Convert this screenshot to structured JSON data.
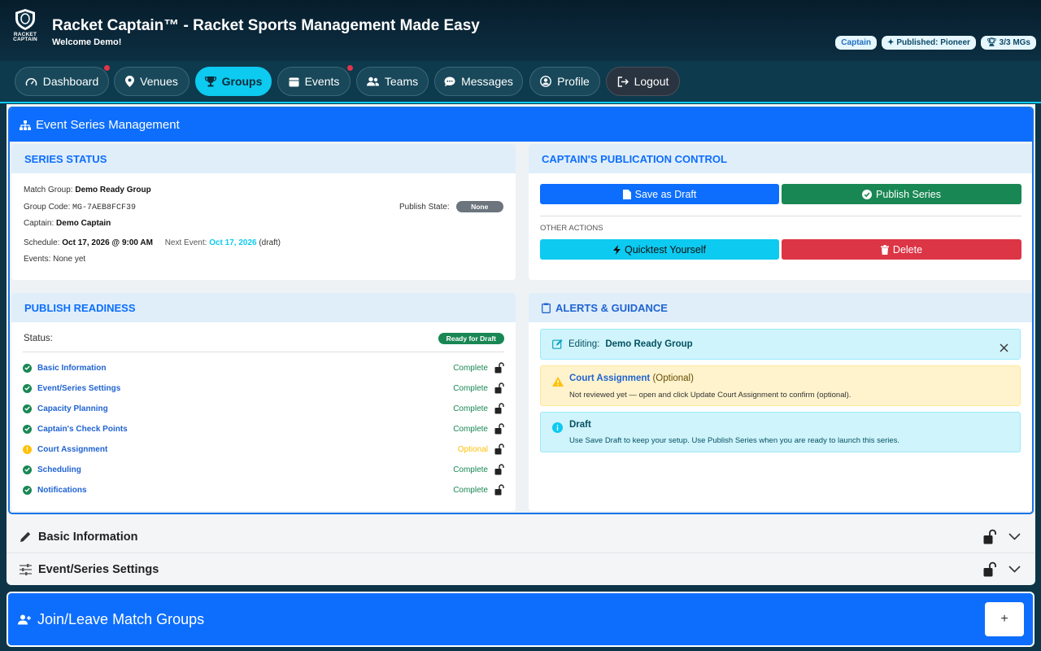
{
  "header": {
    "title": "Racket Captain™ - Racket Sports Management Made Easy",
    "welcome": "Welcome Demo!",
    "logo_text_line1": "RACKET",
    "logo_text_line2": "CAPTAIN",
    "badges": {
      "role": "Captain",
      "published": "Published: Pioneer",
      "mgs": "3/3 MGs"
    }
  },
  "nav": {
    "dashboard": "Dashboard",
    "venues": "Venues",
    "groups": "Groups",
    "events": "Events",
    "teams": "Teams",
    "messages": "Messages",
    "profile": "Profile",
    "logout": "Logout",
    "active": "Groups"
  },
  "esm": {
    "title": "Event Series Management",
    "series_status": {
      "title": "SERIES STATUS",
      "match_group_label": "Match Group:",
      "match_group": "Demo Ready Group",
      "group_code_label": "Group Code:",
      "group_code": "MG-7AEB8FCF39",
      "publish_state_label": "Publish State:",
      "publish_state": "None",
      "captain_label": "Captain:",
      "captain": "Demo Captain",
      "schedule_label": "Schedule:",
      "schedule": "Oct 17, 2026 @ 9:00 AM",
      "next_event_label": "Next Event:",
      "next_event": "Oct 17, 2026",
      "next_event_note": "(draft)",
      "events_label": "Events:",
      "events": "None yet"
    },
    "publication": {
      "title": "CAPTAIN'S PUBLICATION CONTROL",
      "save_draft": "Save as Draft",
      "publish": "Publish Series",
      "other_actions": "OTHER ACTIONS",
      "quicktest": "Quicktest Yourself",
      "delete": "Delete"
    },
    "readiness": {
      "title": "PUBLISH READINESS",
      "status_label": "Status:",
      "status": "Ready for Draft",
      "items": [
        {
          "label": "Basic Information",
          "status": "Complete",
          "state": "ok"
        },
        {
          "label": "Event/Series Settings",
          "status": "Complete",
          "state": "ok"
        },
        {
          "label": "Capacity Planning",
          "status": "Complete",
          "state": "ok"
        },
        {
          "label": "Captain's Check Points",
          "status": "Complete",
          "state": "ok"
        },
        {
          "label": "Court Assignment",
          "status": "Optional",
          "state": "warn"
        },
        {
          "label": "Scheduling",
          "status": "Complete",
          "state": "ok"
        },
        {
          "label": "Notifications",
          "status": "Complete",
          "state": "ok"
        }
      ]
    },
    "alerts": {
      "title": "ALERTS & GUIDANCE",
      "editing_label": "Editing:",
      "editing_value": "Demo Ready Group",
      "court_title": "Court Assignment",
      "court_optional": "(Optional)",
      "court_text": "Not reviewed yet — open and click Update Court Assignment to confirm (optional).",
      "draft_title": "Draft",
      "draft_text": "Use Save Draft to keep your setup. Use Publish Series when you are ready to launch this series."
    }
  },
  "accordions": {
    "basic_info": "Basic Information",
    "event_settings": "Event/Series Settings"
  },
  "join": {
    "title": "Join/Leave Match Groups",
    "plus": "+"
  },
  "colors": {
    "primary": "#0d6efd",
    "active_nav": "#0dcaf0",
    "success": "#198754",
    "danger": "#dc3545",
    "warning": "#ffc107",
    "header_bg": "#071d2c"
  }
}
